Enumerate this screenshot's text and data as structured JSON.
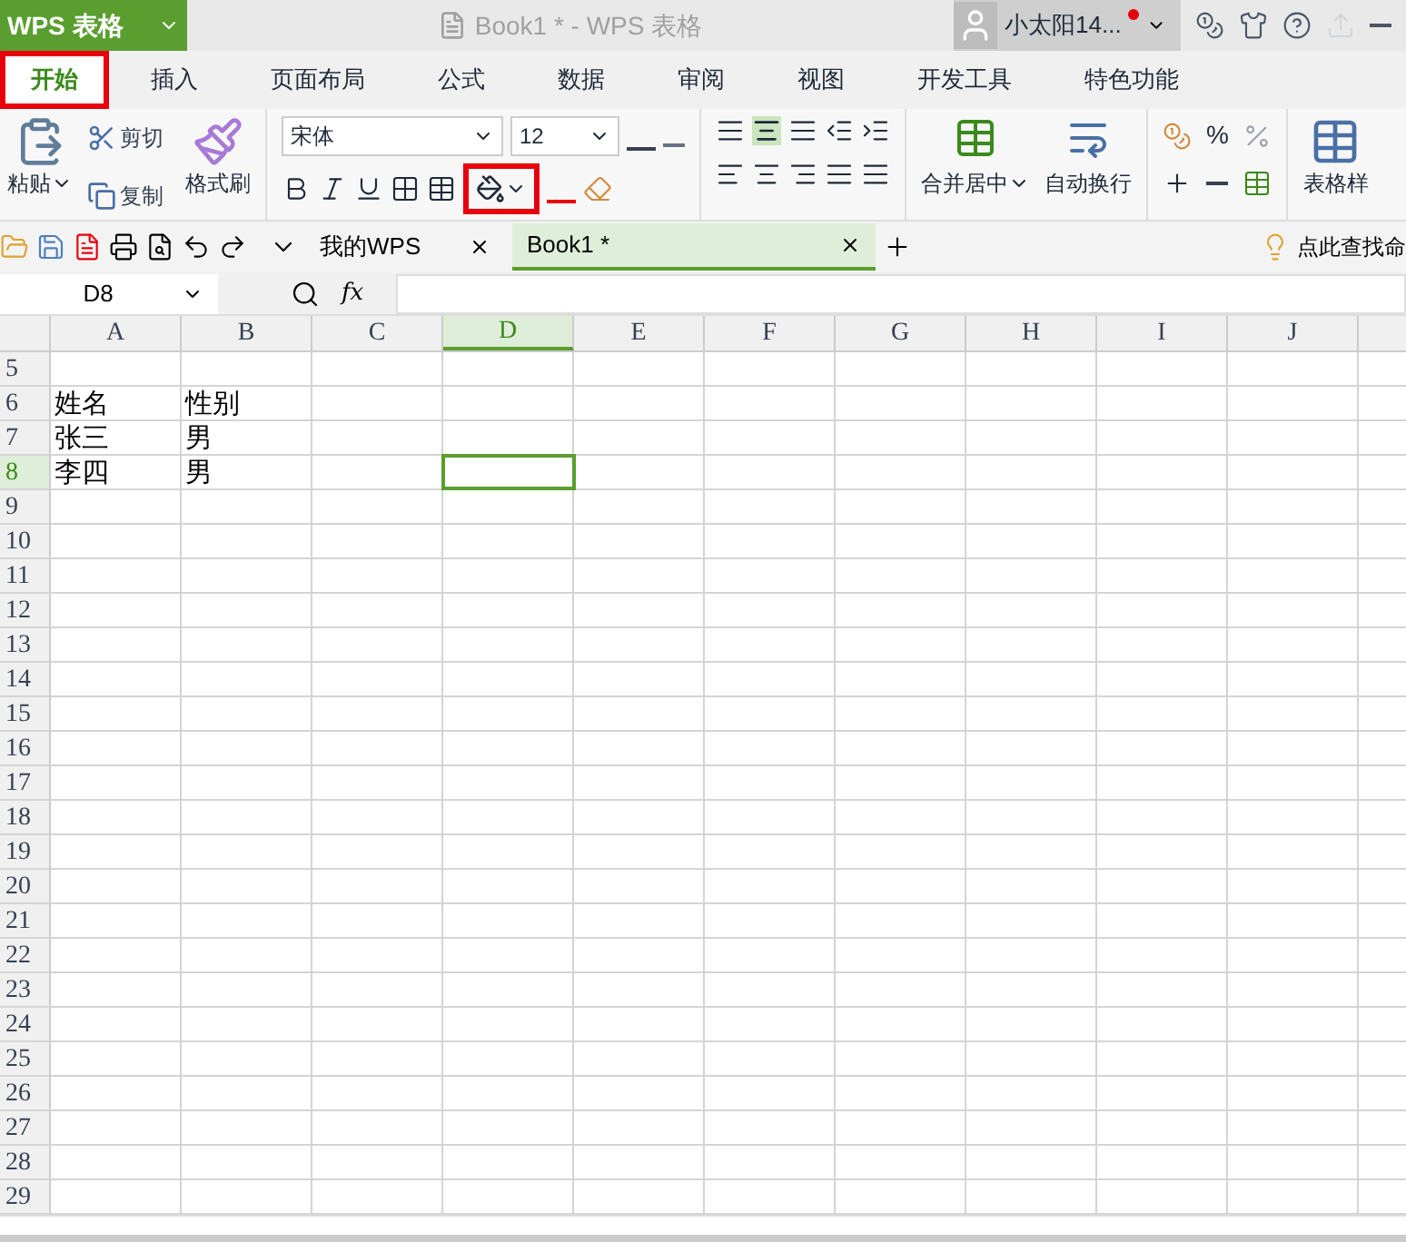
{
  "app_menu": {
    "label": "WPS 表格"
  },
  "title": "Book1 * - WPS 表格",
  "user": {
    "name": "小太阳14..."
  },
  "ribbon_tabs": [
    {
      "label": "开始",
      "selected": true,
      "highlighted": true
    },
    {
      "label": "插入",
      "selected": false,
      "highlighted": false
    },
    {
      "label": "页面布局",
      "selected": false,
      "highlighted": false
    },
    {
      "label": "公式",
      "selected": false,
      "highlighted": false
    },
    {
      "label": "数据",
      "selected": false,
      "highlighted": false
    },
    {
      "label": "审阅",
      "selected": false,
      "highlighted": false
    },
    {
      "label": "视图",
      "selected": false,
      "highlighted": false
    },
    {
      "label": "开发工具",
      "selected": false,
      "highlighted": false
    },
    {
      "label": "特色功能",
      "selected": false,
      "highlighted": false
    }
  ],
  "clipboard": {
    "paste": "粘贴",
    "cut": "剪切",
    "copy": "复制",
    "format_painter": "格式刷"
  },
  "font": {
    "name": "宋体",
    "size": "12",
    "fill_color_highlighted": true
  },
  "alignment": {
    "merge": "合并居中",
    "wrap": "自动换行"
  },
  "number": {
    "percent": "%"
  },
  "table_style": "表格样",
  "doc_tabs": [
    {
      "label": "我的WPS",
      "selected": false
    },
    {
      "label": "Book1 *",
      "selected": true
    }
  ],
  "search_hint": "点此查找命",
  "name_box": "D8",
  "fx_label": "fx",
  "columns": [
    {
      "label": "A",
      "selected": false
    },
    {
      "label": "B",
      "selected": false
    },
    {
      "label": "C",
      "selected": false
    },
    {
      "label": "D",
      "selected": true
    },
    {
      "label": "E",
      "selected": false
    },
    {
      "label": "F",
      "selected": false
    },
    {
      "label": "G",
      "selected": false
    },
    {
      "label": "H",
      "selected": false
    },
    {
      "label": "I",
      "selected": false
    },
    {
      "label": "J",
      "selected": false
    }
  ],
  "rows": [
    {
      "label": "5",
      "selected": false
    },
    {
      "label": "6",
      "selected": false,
      "cells": [
        "姓名",
        "性别"
      ]
    },
    {
      "label": "7",
      "selected": false,
      "cells": [
        "张三",
        "男"
      ]
    },
    {
      "label": "8",
      "selected": true,
      "cells": [
        "李四",
        "男"
      ]
    },
    {
      "label": "9",
      "selected": false
    },
    {
      "label": "10",
      "selected": false
    },
    {
      "label": "11",
      "selected": false
    },
    {
      "label": "12",
      "selected": false
    },
    {
      "label": "13",
      "selected": false
    },
    {
      "label": "14",
      "selected": false
    },
    {
      "label": "15",
      "selected": false
    },
    {
      "label": "16",
      "selected": false
    },
    {
      "label": "17",
      "selected": false
    },
    {
      "label": "18",
      "selected": false
    },
    {
      "label": "19",
      "selected": false
    },
    {
      "label": "20",
      "selected": false
    },
    {
      "label": "21",
      "selected": false
    },
    {
      "label": "22",
      "selected": false
    },
    {
      "label": "23",
      "selected": false
    },
    {
      "label": "24",
      "selected": false
    },
    {
      "label": "25",
      "selected": false
    },
    {
      "label": "26",
      "selected": false
    },
    {
      "label": "27",
      "selected": false
    },
    {
      "label": "28",
      "selected": false
    },
    {
      "label": "29",
      "selected": false
    }
  ]
}
